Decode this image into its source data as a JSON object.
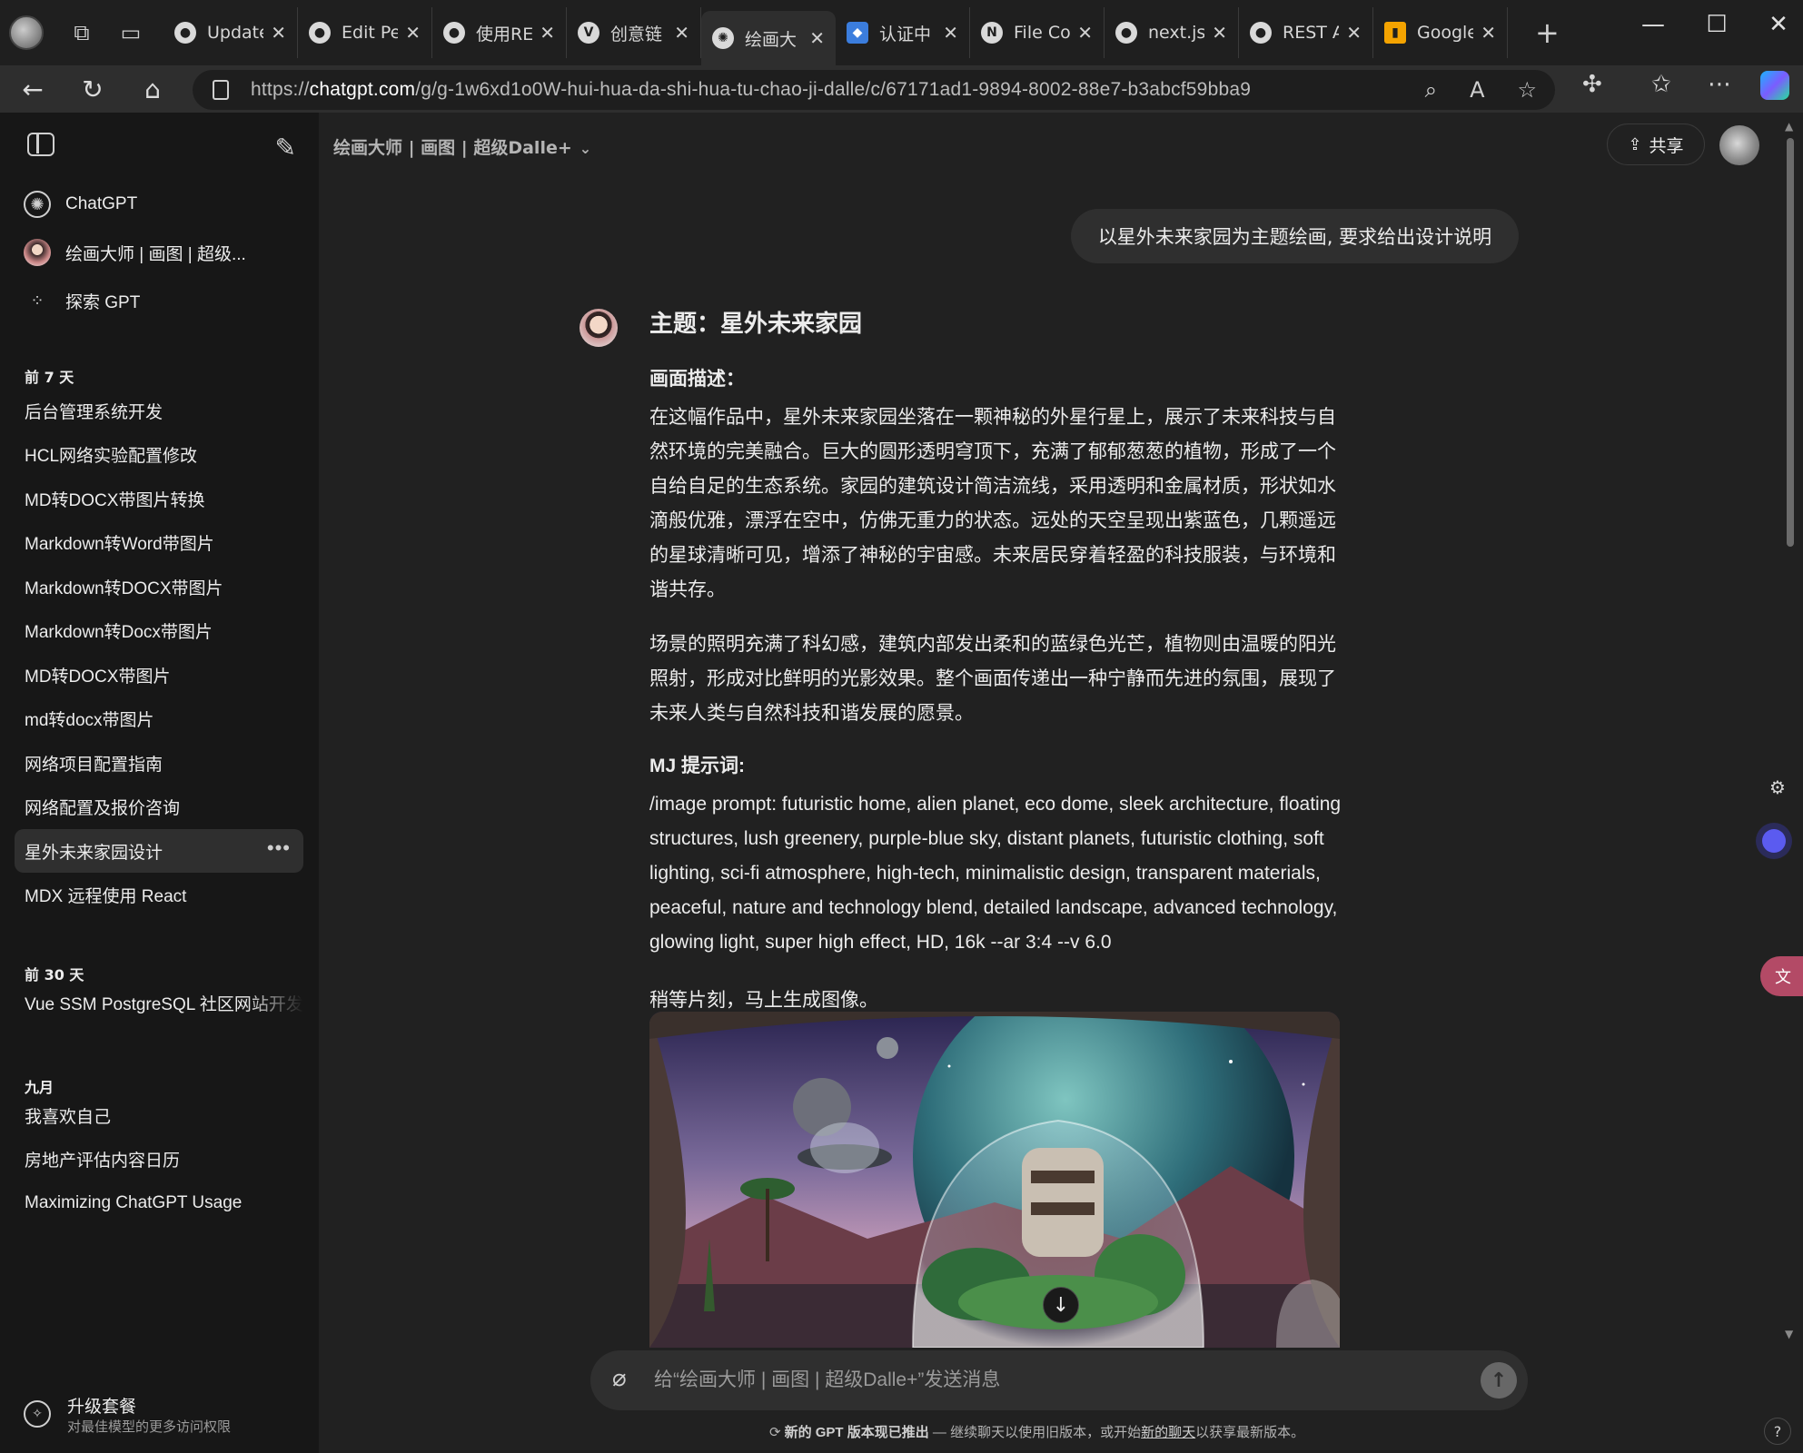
{
  "browser": {
    "tabs": [
      {
        "label": "Update",
        "icon": "github-icon"
      },
      {
        "label": "Edit Pe",
        "icon": "github-icon"
      },
      {
        "label": "使用RE",
        "icon": "github-icon"
      },
      {
        "label": "创意链",
        "icon": "vg-icon"
      },
      {
        "label": "绘画大",
        "icon": "chatgpt-icon",
        "active": true
      },
      {
        "label": "认证中",
        "icon": "shield-icon"
      },
      {
        "label": "File Co",
        "icon": "notion-icon"
      },
      {
        "label": "next.js/",
        "icon": "github-icon"
      },
      {
        "label": "REST A",
        "icon": "github-icon"
      },
      {
        "label": "Google",
        "icon": "analytics-icon"
      }
    ],
    "url_prefix": "https://",
    "url_host": "chatgpt.com",
    "url_path": "/g/g-1w6xd1o0W-hui-hua-da-shi-hua-tu-chao-ji-dalle/c/67171ad1-9894-8002-88e7-b3abcf59bba9"
  },
  "sidebar": {
    "top_items": [
      {
        "label": "ChatGPT",
        "icon": "chatgpt-logo-icon"
      },
      {
        "label": "绘画大师 | 画图 | 超级...",
        "icon": "gpt-avatar"
      },
      {
        "label": "探索 GPT",
        "icon": "grid-icon"
      }
    ],
    "sections": [
      {
        "title": "前 7 天",
        "items": [
          "后台管理系统开发",
          "HCL网络实验配置修改",
          "MD转DOCX带图片转换",
          "Markdown转Word带图片",
          "Markdown转DOCX带图片",
          "Markdown转Docx带图片",
          "MD转DOCX带图片",
          "md转docx带图片",
          "网络项目配置指南",
          "网络配置及报价咨询",
          "星外未来家园设计",
          "MDX 远程使用 React"
        ]
      },
      {
        "title": "前 30 天",
        "items": [
          "Vue SSM PostgreSQL 社区网站开发"
        ]
      },
      {
        "title": "九月",
        "items": [
          "我喜欢自己",
          "房地产评估内容日历",
          "Maximizing ChatGPT Usage"
        ]
      }
    ],
    "upgrade_title": "升级套餐",
    "upgrade_sub": "对最佳模型的更多访问权限"
  },
  "header": {
    "model_title": "绘画大师 | 画图 | 超级Dalle+",
    "share_label": "共享"
  },
  "conversation": {
    "user_message": "以星外未来家园为主题绘画, 要求给出设计说明",
    "heading": "主题：星外未来家园",
    "desc_heading": "画面描述：",
    "para1": "在这幅作品中，星外未来家园坐落在一颗神秘的外星行星上，展示了未来科技与自然环境的完美融合。巨大的圆形透明穹顶下，充满了郁郁葱葱的植物，形成了一个自给自足的生态系统。家园的建筑设计简洁流线，采用透明和金属材质，形状如水滴般优雅，漂浮在空中，仿佛无重力的状态。远处的天空呈现出紫蓝色，几颗遥远的星球清晰可见，增添了神秘的宇宙感。未来居民穿着轻盈的科技服装，与环境和谐共存。",
    "para2": "场景的照明充满了科幻感，建筑内部发出柔和的蓝绿色光芒，植物则由温暖的阳光照射，形成对比鲜明的光影效果。整个画面传递出一种宁静而先进的氛围，展现了未来人类与自然科技和谐发展的愿景。",
    "mj_heading": "MJ 提示词:",
    "mj_prompt": "/image prompt: futuristic home, alien planet, eco dome, sleek architecture, floating structures, lush greenery, purple-blue sky, distant planets, futuristic clothing, soft lighting, sci-fi atmosphere, high-tech, minimalistic design, transparent materials, peaceful, nature and technology blend, detailed landscape, advanced technology, glowing light, super high effect, HD, 16k --ar 3:4 --v 6.0",
    "waiting": "稍等片刻，马上生成图像。"
  },
  "composer": {
    "placeholder": "给“绘画大师 | 画图 | 超级Dalle+”发送消息"
  },
  "notice": {
    "bold": "新的 GPT 版本现已推出",
    "text_a": " — 继续聊天以使用旧版本，或开始",
    "link": "新的聊天",
    "text_b": "以获享最新版本。"
  },
  "help_label": "?"
}
